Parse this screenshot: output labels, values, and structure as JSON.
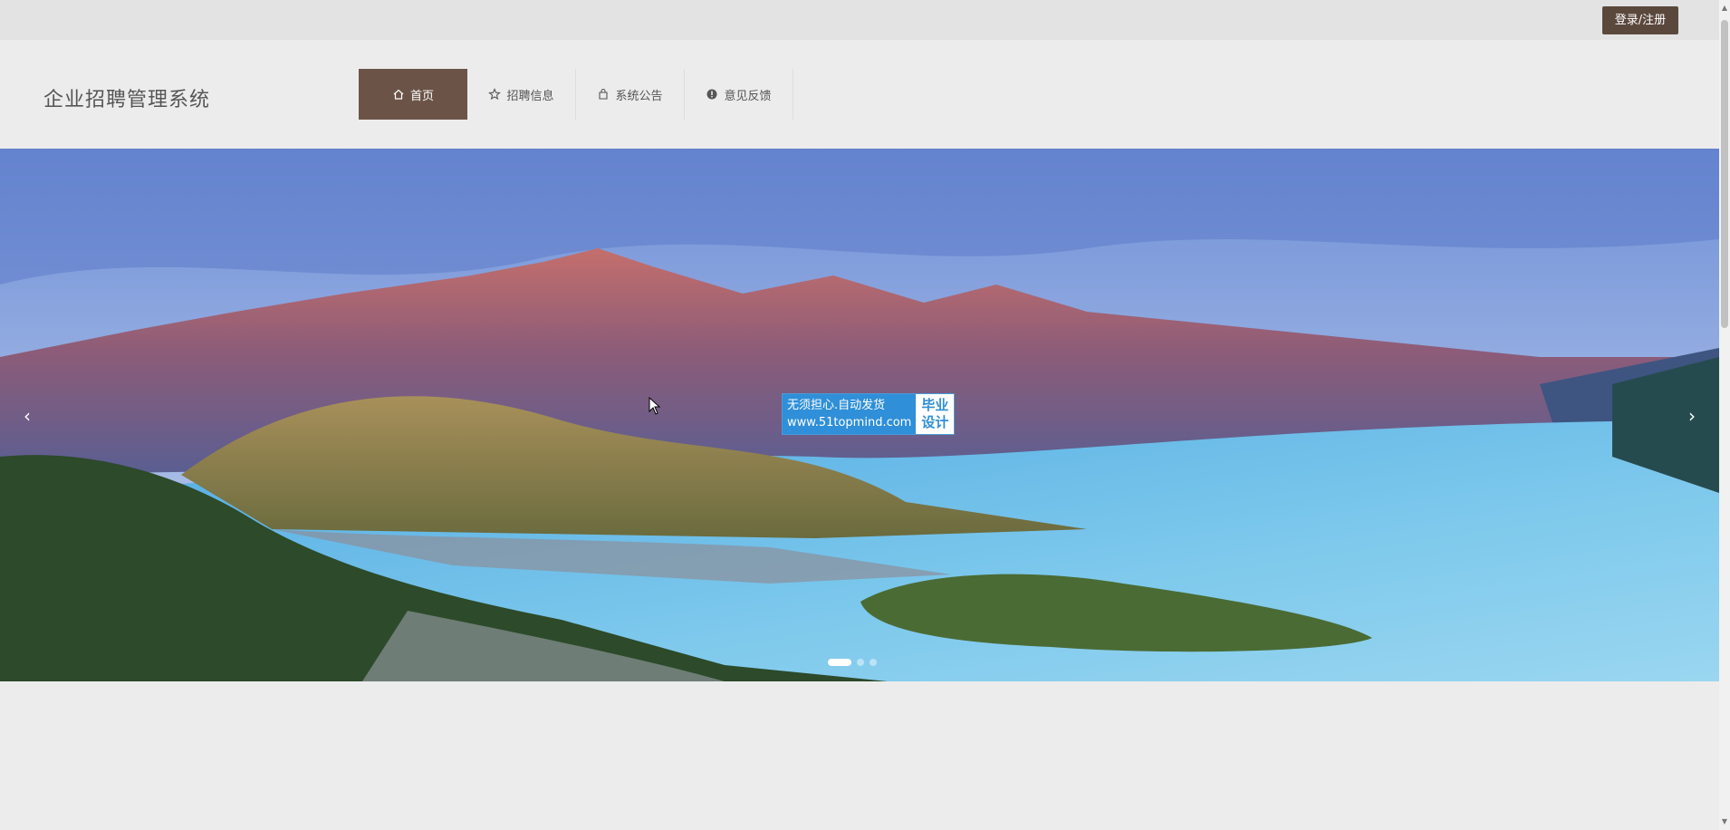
{
  "topbar": {
    "login_label": "登录/注册"
  },
  "header": {
    "site_title": "企业招聘管理系统"
  },
  "nav": {
    "items": [
      {
        "label": "首页",
        "icon": "home-icon",
        "active": true
      },
      {
        "label": "招聘信息",
        "icon": "star-icon",
        "active": false
      },
      {
        "label": "系统公告",
        "icon": "bag-icon",
        "active": false
      },
      {
        "label": "意见反馈",
        "icon": "alert-icon",
        "active": false
      }
    ]
  },
  "banner": {
    "prev_arrow": "‹",
    "next_arrow": "›",
    "slides": 3,
    "active_slide": 1,
    "watermark": {
      "line1": "无须担心.自动发货",
      "line2": "www.51topmind.com",
      "tag1": "毕业",
      "tag2": "设计"
    }
  },
  "colors": {
    "accent": "#6b5447",
    "login_bg": "#5b483d",
    "page_bg": "#ececec"
  }
}
